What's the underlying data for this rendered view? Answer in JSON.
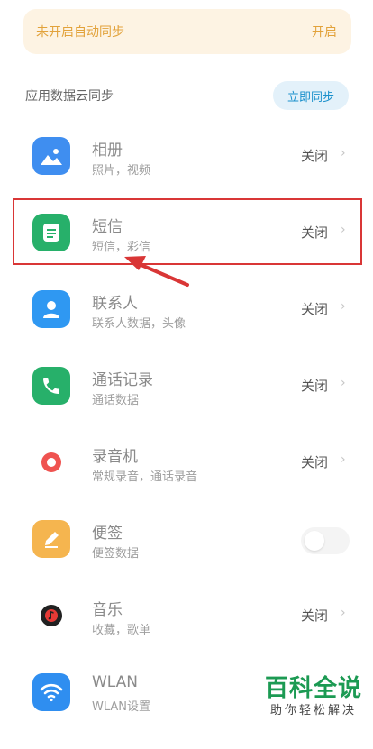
{
  "banner": {
    "text": "未开启自动同步",
    "action": "开启"
  },
  "section": {
    "title": "应用数据云同步",
    "sync_button": "立即同步"
  },
  "items": [
    {
      "name": "相册",
      "sub": "照片，视频",
      "status": "关闭",
      "icon": "gallery-icon",
      "icon_color": "#3f8ef0"
    },
    {
      "name": "短信",
      "sub": "短信，彩信",
      "status": "关闭",
      "icon": "message-icon",
      "icon_color": "#27b06a"
    },
    {
      "name": "联系人",
      "sub": "联系人数据，头像",
      "status": "关闭",
      "icon": "contacts-icon",
      "icon_color": "#2f98f2"
    },
    {
      "name": "通话记录",
      "sub": "通话数据",
      "status": "关闭",
      "icon": "phone-icon",
      "icon_color": "#27b06a"
    },
    {
      "name": "录音机",
      "sub": "常规录音，通话录音",
      "status": "关闭",
      "icon": "recorder-icon",
      "icon_color": "#ef5350"
    },
    {
      "name": "便签",
      "sub": "便签数据",
      "status": "",
      "toggle_on": false,
      "icon": "notes-icon",
      "icon_color": "#f5b54f"
    },
    {
      "name": "音乐",
      "sub": "收藏，歌单",
      "status": "关闭",
      "icon": "music-icon",
      "icon_color": "#e53935"
    },
    {
      "name": "WLAN",
      "sub": "WLAN设置",
      "status": "",
      "icon": "wifi-icon",
      "icon_color": "#2f8ef0"
    }
  ],
  "watermark": {
    "title": "百科全说",
    "subtitle": "助你轻松解决"
  }
}
